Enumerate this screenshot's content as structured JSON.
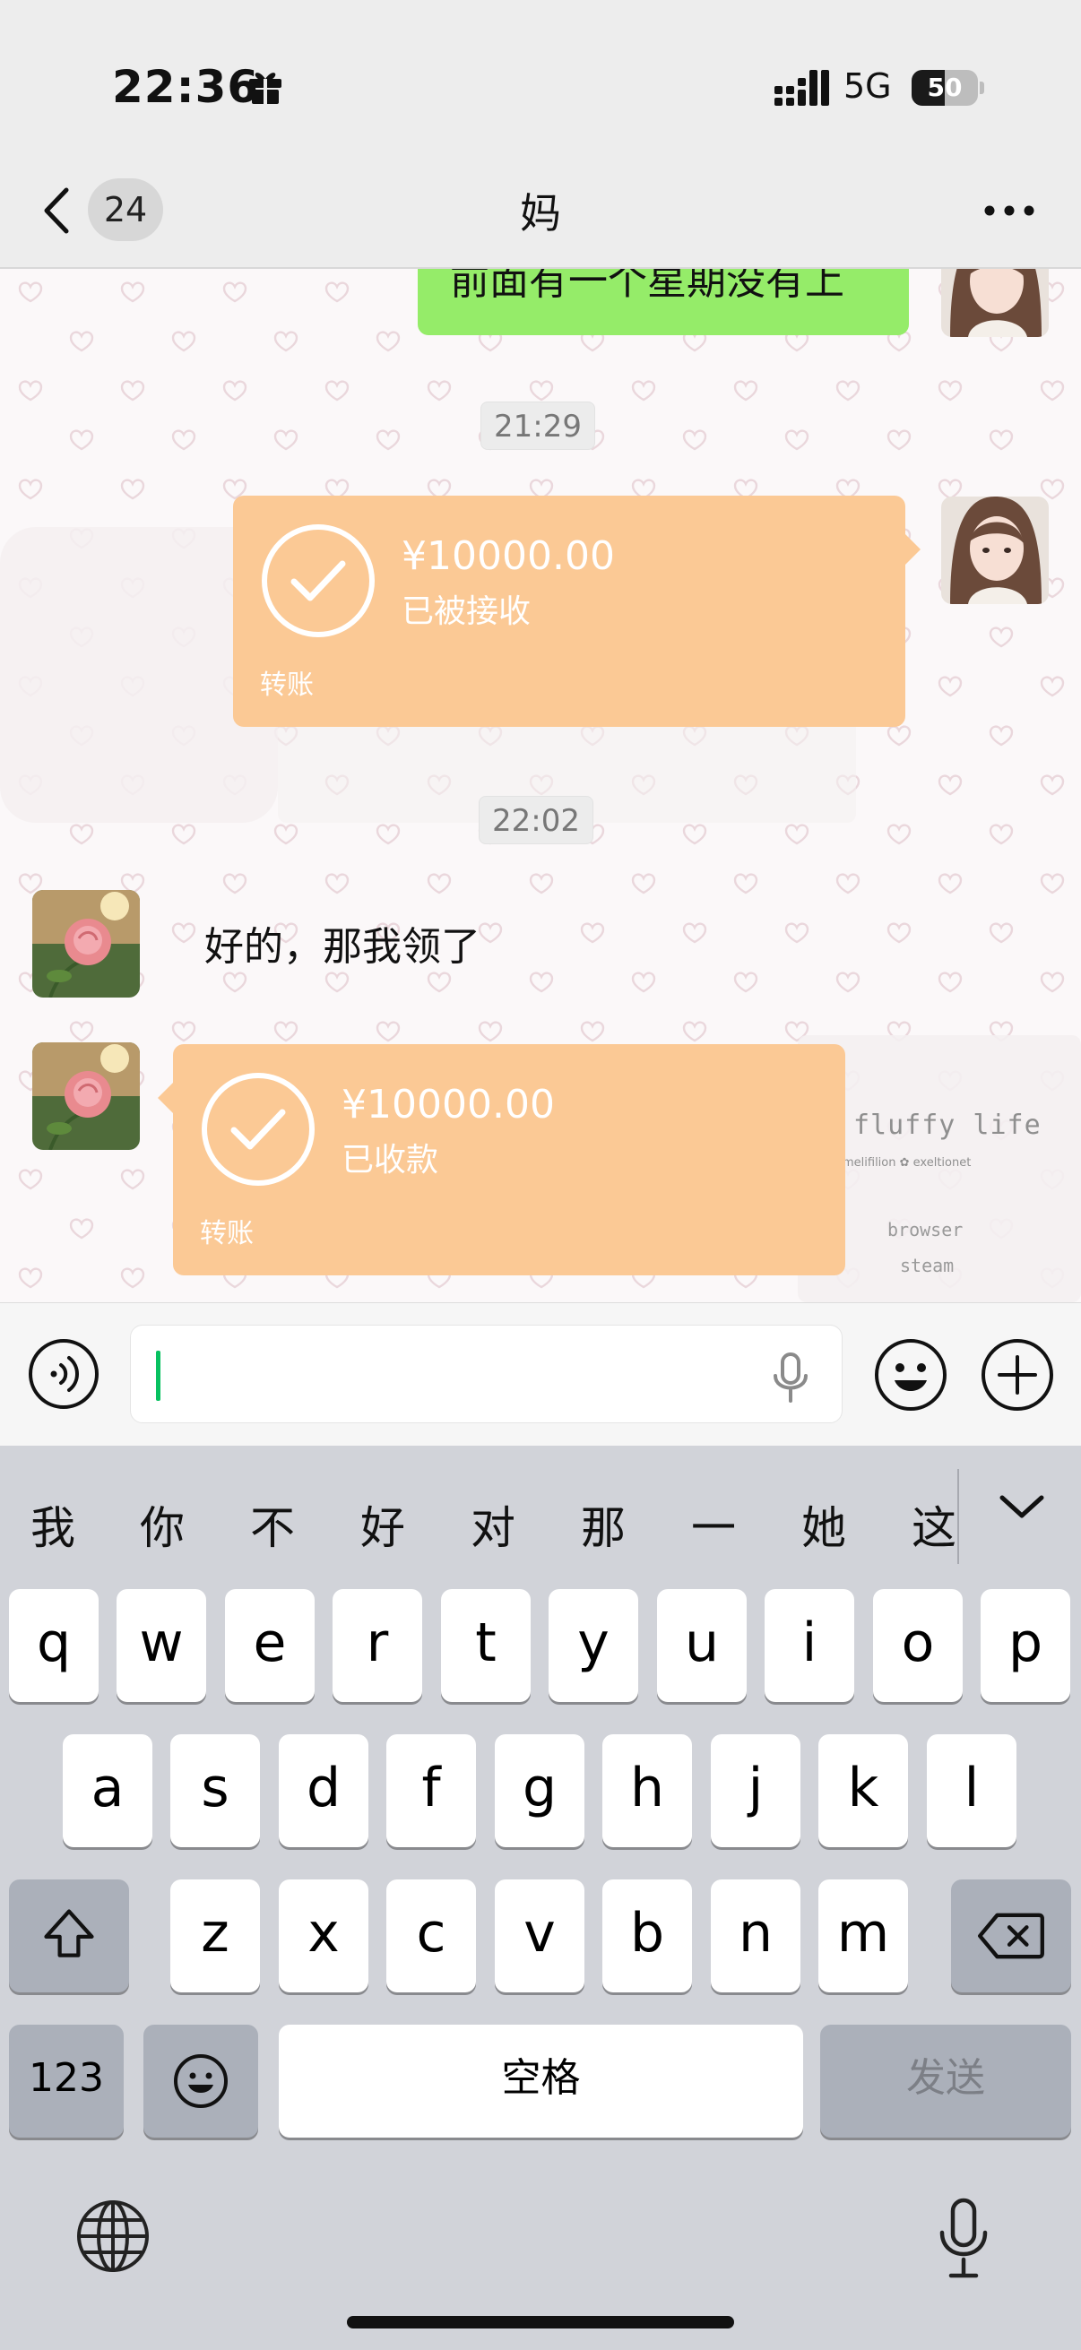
{
  "status_bar": {
    "time": "22:36",
    "network": "5G",
    "battery": "50",
    "battery_level_percent": 50
  },
  "nav": {
    "back_count": "24",
    "title": "妈"
  },
  "chat": {
    "messages": [
      {
        "type": "text",
        "side": "right",
        "text": "前面有一个星期没有上"
      },
      {
        "type": "time",
        "text": "21:29"
      },
      {
        "type": "transfer",
        "side": "right",
        "amount": "¥10000.00",
        "status": "已被接收",
        "label": "转账"
      },
      {
        "type": "time",
        "text": "22:02"
      },
      {
        "type": "text",
        "side": "left",
        "text": "好的，那我领了"
      },
      {
        "type": "transfer",
        "side": "left",
        "amount": "¥10000.00",
        "status": "已收款",
        "label": "转账"
      }
    ],
    "background_text": {
      "title": "fluffy life",
      "subtitle": "melifilion ✿ exeltionet",
      "items": [
        "browser",
        "steam"
      ]
    },
    "colors": {
      "self_bubble": "#95ec69",
      "transfer_card": "#fbc995"
    }
  },
  "input_bar": {
    "value": "",
    "icons": [
      "voice-icon",
      "mic-icon",
      "emoji-icon",
      "plus-icon"
    ],
    "cursor_color": "#07c160"
  },
  "keyboard": {
    "candidates": [
      "我",
      "你",
      "不",
      "好",
      "对",
      "那",
      "一",
      "她",
      "这"
    ],
    "row1": [
      "q",
      "w",
      "e",
      "r",
      "t",
      "y",
      "u",
      "i",
      "o",
      "p"
    ],
    "row2": [
      "a",
      "s",
      "d",
      "f",
      "g",
      "h",
      "j",
      "k",
      "l"
    ],
    "row3": [
      "z",
      "x",
      "c",
      "v",
      "b",
      "n",
      "m"
    ],
    "numbers_label": "123",
    "space_label": "空格",
    "send_label": "发送",
    "icons": [
      "shift-icon",
      "delete-icon",
      "emoji-icon",
      "globe-icon",
      "dictation-icon",
      "chevron-down-icon"
    ]
  }
}
